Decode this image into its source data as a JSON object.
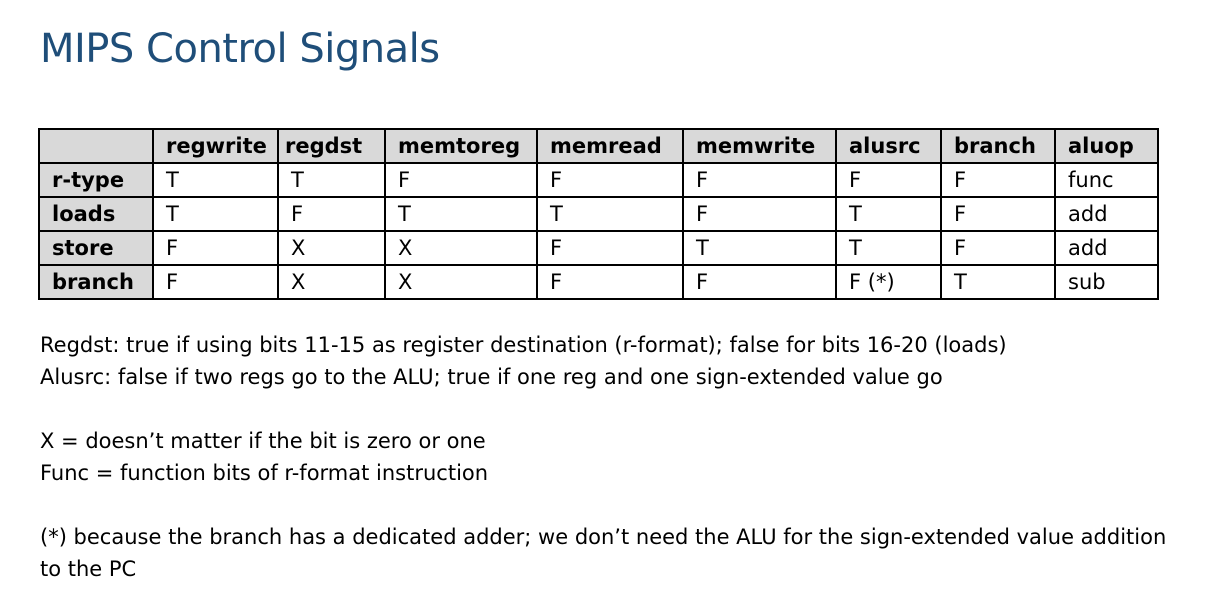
{
  "title": "MIPS Control Signals",
  "table": {
    "corner": "",
    "columns": [
      "regwrite",
      "regdst",
      "memtoreg",
      "memread",
      "memwrite",
      "alusrc",
      "branch",
      "aluop"
    ],
    "rows": [
      {
        "label": "r-type",
        "cells": [
          "T",
          "T",
          "F",
          "F",
          "F",
          "F",
          "F",
          "func"
        ]
      },
      {
        "label": "loads",
        "cells": [
          "T",
          "F",
          "T",
          "T",
          "F",
          "T",
          "F",
          "add"
        ]
      },
      {
        "label": "store",
        "cells": [
          "F",
          "X",
          "X",
          "F",
          "T",
          "T",
          "F",
          "add"
        ]
      },
      {
        "label": "branch",
        "cells": [
          "F",
          "X",
          "X",
          "F",
          "F",
          "F (*)",
          "T",
          "sub"
        ]
      }
    ]
  },
  "notes": {
    "regdst": "Regdst: true if using bits 11-15 as register destination (r-format); false for bits 16-20 (loads)",
    "alusrc": "Alusrc: false if two regs go to the ALU; true if one reg and one sign-extended value go",
    "x_meaning": "X = doesn’t matter if the bit is zero or one",
    "func_meaning": "Func = function bits of r-format instruction",
    "footnote": "(*) because the branch has a dedicated adder; we don’t need the ALU for the sign-extended value addition to the PC"
  },
  "colors": {
    "title": "#1f4e79",
    "header_fill": "#d9d9d9",
    "border": "#000000"
  }
}
